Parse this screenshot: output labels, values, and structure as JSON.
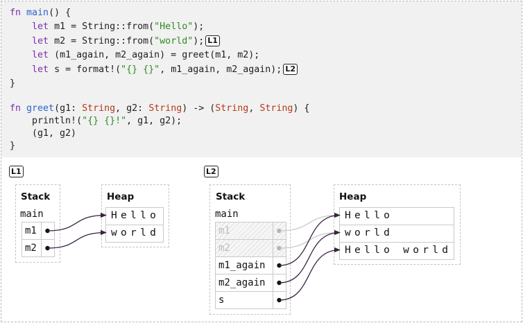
{
  "code": {
    "lines": [
      [
        {
          "t": "fn ",
          "c": "kw"
        },
        {
          "t": "main",
          "c": "fnname"
        },
        {
          "t": "() {",
          "c": ""
        }
      ],
      [
        {
          "t": "    ",
          "c": ""
        },
        {
          "t": "let",
          "c": "kw"
        },
        {
          "t": " m1 = String::from(",
          "c": ""
        },
        {
          "t": "\"Hello\"",
          "c": "str"
        },
        {
          "t": ");",
          "c": ""
        }
      ],
      [
        {
          "t": "    ",
          "c": ""
        },
        {
          "t": "let",
          "c": "kw"
        },
        {
          "t": " m2 = String::from(",
          "c": ""
        },
        {
          "t": "\"world\"",
          "c": "str"
        },
        {
          "t": ");",
          "c": ""
        }
      ],
      [
        {
          "t": "    ",
          "c": ""
        },
        {
          "t": "let",
          "c": "kw"
        },
        {
          "t": " (m1_again, m2_again) = greet(m1, m2);",
          "c": ""
        }
      ],
      [
        {
          "t": "    ",
          "c": ""
        },
        {
          "t": "let",
          "c": "kw"
        },
        {
          "t": " s = format!(",
          "c": ""
        },
        {
          "t": "\"{} {}\"",
          "c": "str"
        },
        {
          "t": ", m1_again, m2_again);",
          "c": ""
        }
      ],
      [
        {
          "t": "}",
          "c": ""
        }
      ],
      [],
      [
        {
          "t": "fn ",
          "c": "kw"
        },
        {
          "t": "greet",
          "c": "fnname"
        },
        {
          "t": "(g1: ",
          "c": ""
        },
        {
          "t": "String",
          "c": "ty"
        },
        {
          "t": ", g2: ",
          "c": ""
        },
        {
          "t": "String",
          "c": "ty"
        },
        {
          "t": ") -> (",
          "c": ""
        },
        {
          "t": "String",
          "c": "ty"
        },
        {
          "t": ", ",
          "c": ""
        },
        {
          "t": "String",
          "c": "ty"
        },
        {
          "t": ") {",
          "c": ""
        }
      ],
      [
        {
          "t": "    println!(",
          "c": ""
        },
        {
          "t": "\"{} {}!\"",
          "c": "str"
        },
        {
          "t": ", g1, g2);",
          "c": ""
        }
      ],
      [
        {
          "t": "    (g1, g2)",
          "c": ""
        }
      ],
      [
        {
          "t": "}",
          "c": ""
        }
      ]
    ],
    "markers": [
      {
        "line": 2,
        "label": "L1"
      },
      {
        "line": 4,
        "label": "L2"
      }
    ]
  },
  "diagrams": {
    "l1": {
      "label": "L1",
      "stack_title": "Stack",
      "frame_name": "main",
      "heap_title": "Heap",
      "vars": [
        {
          "name": "m1",
          "moved": false
        },
        {
          "name": "m2",
          "moved": false
        }
      ],
      "heap": [
        "Hello",
        "world"
      ]
    },
    "l2": {
      "label": "L2",
      "stack_title": "Stack",
      "frame_name": "main",
      "heap_title": "Heap",
      "vars": [
        {
          "name": "m1",
          "moved": true
        },
        {
          "name": "m2",
          "moved": true
        },
        {
          "name": "m1_again",
          "moved": false
        },
        {
          "name": "m2_again",
          "moved": false
        },
        {
          "name": "s",
          "moved": false
        }
      ],
      "heap": [
        "Hello",
        "world",
        "Hello world"
      ]
    }
  },
  "colors": {
    "pointer": "#3a2240",
    "pointer_moved": "#c8c8c8",
    "keyword": "#7a2fae",
    "function": "#2b63c8",
    "type": "#b33a1a",
    "string": "#2f8a22"
  }
}
